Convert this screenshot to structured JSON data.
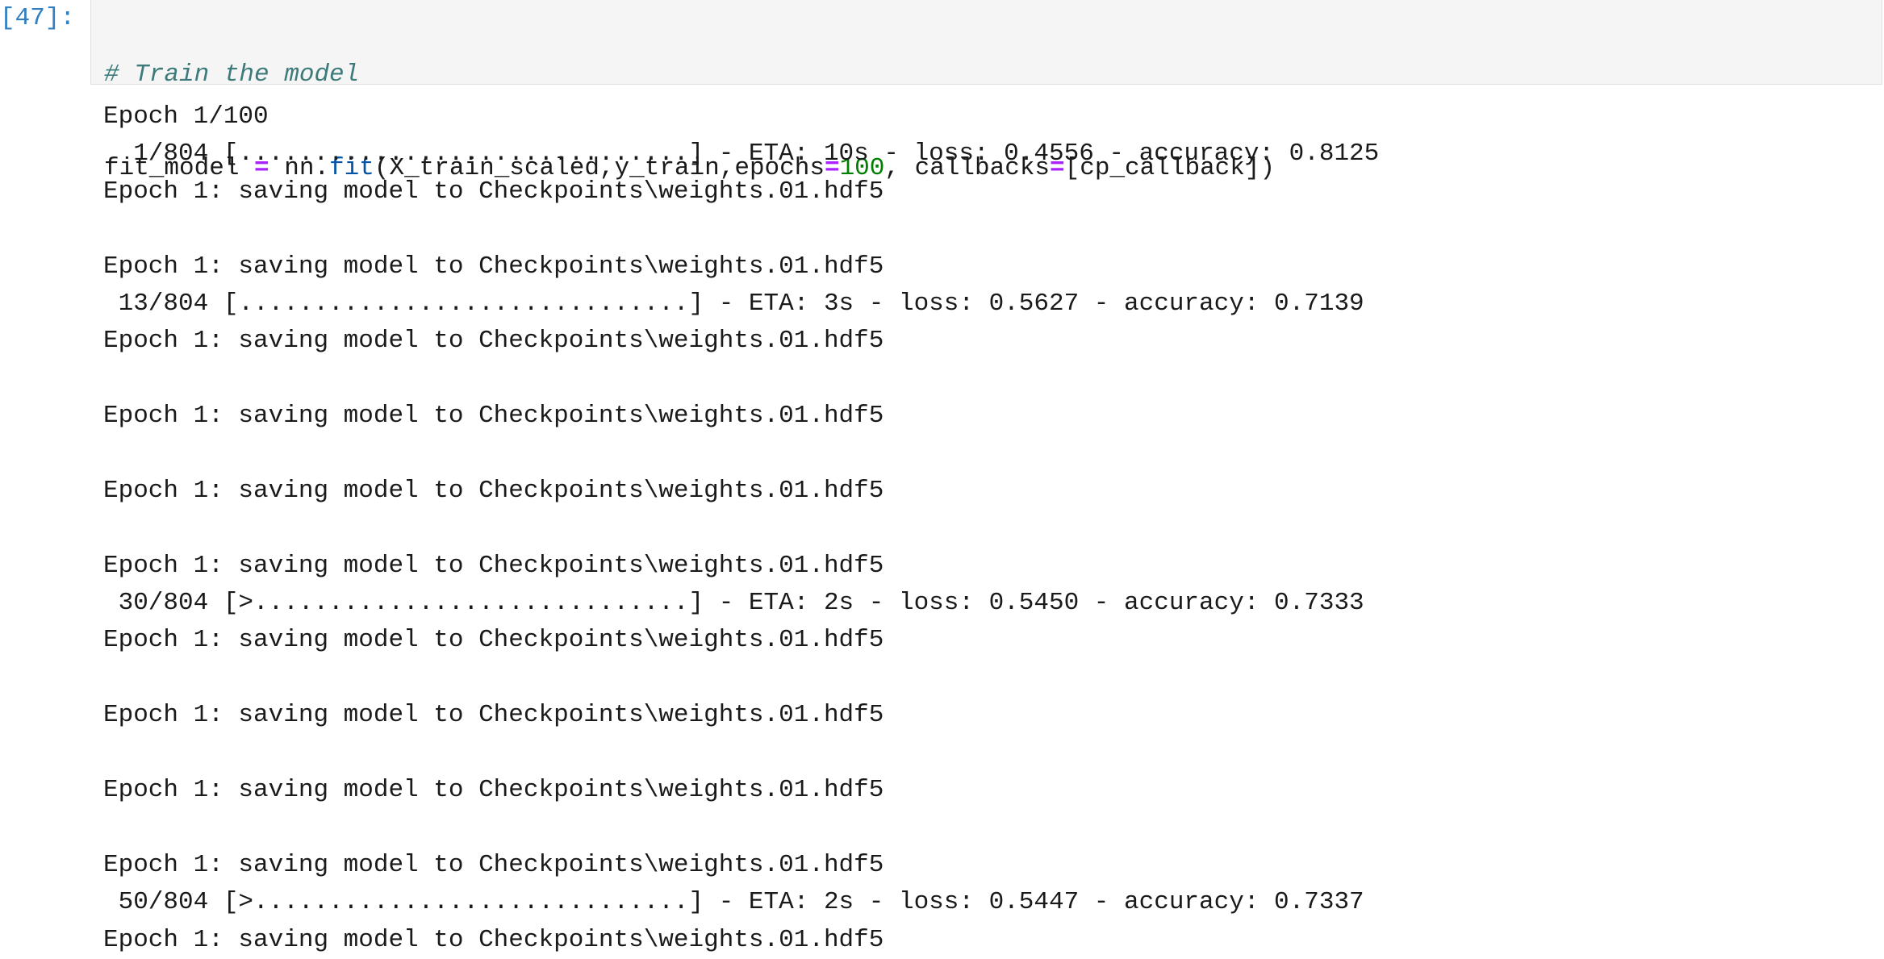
{
  "cell": {
    "prompt": "[47]:",
    "comment": "# Train the model",
    "code": {
      "var": "fit_model ",
      "eq": "=",
      "obj": " nn.",
      "fn": "fit",
      "args1": "(X_train_scaled,y_train,epochs",
      "eq2": "=",
      "num": "100",
      "args2": ", callbacks",
      "eq3": "=",
      "args3": "[cp_callback])"
    }
  },
  "output": [
    "Epoch 1/100",
    "  1/804 [..............................] - ETA: 10s - loss: 0.4556 - accuracy: 0.8125",
    "Epoch 1: saving model to Checkpoints\\weights.01.hdf5",
    "",
    "Epoch 1: saving model to Checkpoints\\weights.01.hdf5",
    " 13/804 [..............................] - ETA: 3s - loss: 0.5627 - accuracy: 0.7139",
    "Epoch 1: saving model to Checkpoints\\weights.01.hdf5",
    "",
    "Epoch 1: saving model to Checkpoints\\weights.01.hdf5",
    "",
    "Epoch 1: saving model to Checkpoints\\weights.01.hdf5",
    "",
    "Epoch 1: saving model to Checkpoints\\weights.01.hdf5",
    " 30/804 [>.............................] - ETA: 2s - loss: 0.5450 - accuracy: 0.7333",
    "Epoch 1: saving model to Checkpoints\\weights.01.hdf5",
    "",
    "Epoch 1: saving model to Checkpoints\\weights.01.hdf5",
    "",
    "Epoch 1: saving model to Checkpoints\\weights.01.hdf5",
    "",
    "Epoch 1: saving model to Checkpoints\\weights.01.hdf5",
    " 50/804 [>.............................] - ETA: 2s - loss: 0.5447 - accuracy: 0.7337",
    "Epoch 1: saving model to Checkpoints\\weights.01.hdf5"
  ]
}
